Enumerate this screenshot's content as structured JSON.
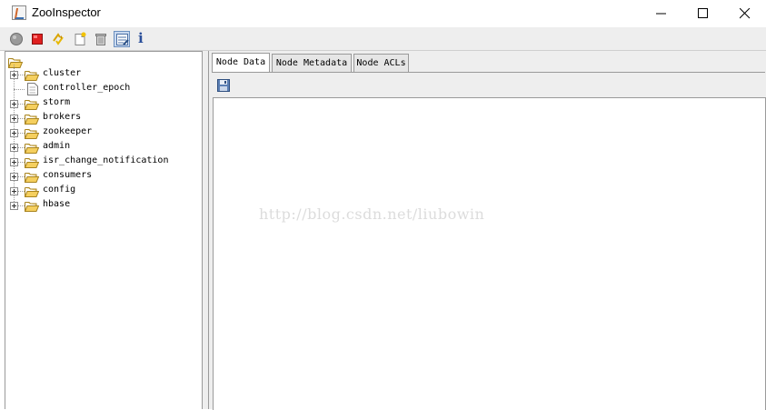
{
  "window": {
    "title": "ZooInspector",
    "controls": {
      "minimize": "minimize-icon",
      "maximize": "maximize-icon",
      "close": "close-icon"
    }
  },
  "toolbar": {
    "buttons": [
      {
        "name": "connect",
        "icon": "connect-icon"
      },
      {
        "name": "disconnect",
        "icon": "stop-icon"
      },
      {
        "name": "refresh",
        "icon": "refresh-icon"
      },
      {
        "name": "add-node",
        "icon": "add-node-icon"
      },
      {
        "name": "delete-node",
        "icon": "trash-icon"
      },
      {
        "name": "node-viewers",
        "icon": "viewers-icon"
      },
      {
        "name": "about",
        "icon": "info-icon"
      }
    ],
    "info_glyph": "i"
  },
  "tree": {
    "root_icon": "folder-open-icon",
    "nodes": [
      {
        "label": "cluster",
        "type": "folder"
      },
      {
        "label": "controller_epoch",
        "type": "leaf"
      },
      {
        "label": "storm",
        "type": "folder"
      },
      {
        "label": "brokers",
        "type": "folder"
      },
      {
        "label": "zookeeper",
        "type": "folder"
      },
      {
        "label": "admin",
        "type": "folder"
      },
      {
        "label": "isr_change_notification",
        "type": "folder"
      },
      {
        "label": "consumers",
        "type": "folder"
      },
      {
        "label": "config",
        "type": "folder"
      },
      {
        "label": "hbase",
        "type": "folder"
      }
    ]
  },
  "tabs": [
    {
      "label": "Node Data",
      "active": true
    },
    {
      "label": "Node Metadata",
      "active": false
    },
    {
      "label": "Node ACLs",
      "active": false
    }
  ],
  "editor": {
    "save_icon": "save-icon",
    "content": ""
  },
  "watermark": "http://blog.csdn.net/liubowin"
}
